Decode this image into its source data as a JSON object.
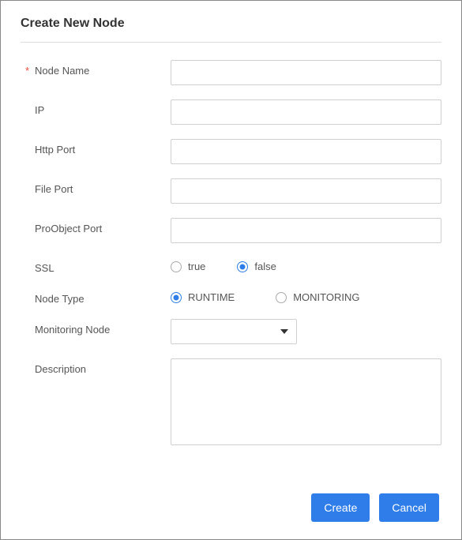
{
  "dialog": {
    "title": "Create New Node"
  },
  "labels": {
    "nodeName": "Node Name",
    "ip": "IP",
    "httpPort": "Http Port",
    "filePort": "File Port",
    "proObjectPort": "ProObject Port",
    "ssl": "SSL",
    "nodeType": "Node Type",
    "monitoringNode": "Monitoring Node",
    "description": "Description",
    "requiredMark": "*"
  },
  "values": {
    "nodeName": "",
    "ip": "",
    "httpPort": "",
    "filePort": "",
    "proObjectPort": "",
    "monitoringNode": "",
    "description": ""
  },
  "ssl": {
    "options": {
      "true": "true",
      "false": "false"
    },
    "selected": "false"
  },
  "nodeType": {
    "options": {
      "runtime": "RUNTIME",
      "monitoring": "MONITORING"
    },
    "selected": "runtime"
  },
  "buttons": {
    "create": "Create",
    "cancel": "Cancel"
  }
}
